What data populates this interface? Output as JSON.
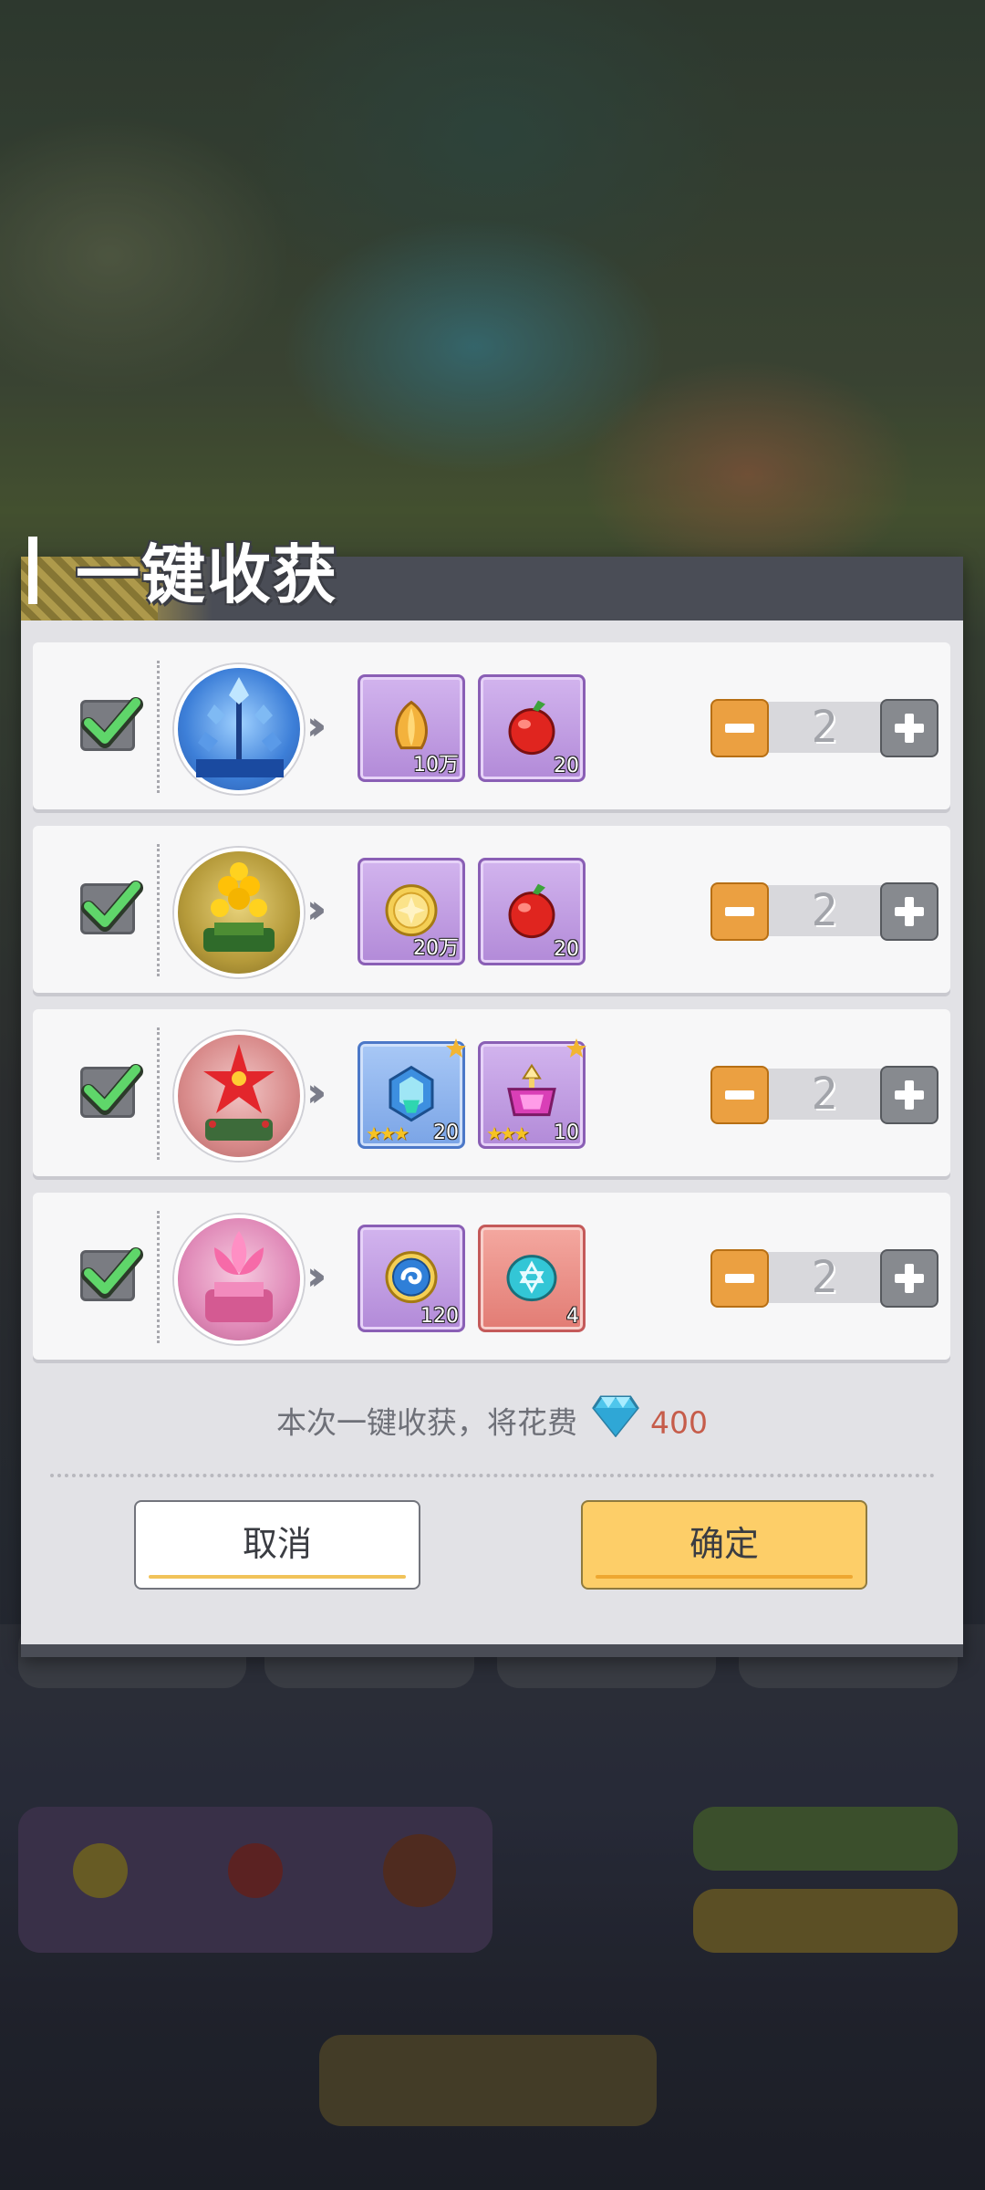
{
  "dialog": {
    "title": "一键收获",
    "rows": [
      {
        "checked": true,
        "plant_icon": "blue-crystal-plant-icon",
        "quantity": "2",
        "rewards": [
          {
            "icon": "golden-tulip-icon",
            "amount": "10万",
            "rarity": "purple"
          },
          {
            "icon": "red-apple-icon",
            "amount": "20",
            "rarity": "purple"
          }
        ]
      },
      {
        "checked": true,
        "plant_icon": "yellow-flower-plant-icon",
        "quantity": "2",
        "rewards": [
          {
            "icon": "gold-coin-icon",
            "amount": "20万",
            "rarity": "purple"
          },
          {
            "icon": "red-apple-icon",
            "amount": "20",
            "rarity": "purple"
          }
        ]
      },
      {
        "checked": true,
        "plant_icon": "red-poinsettia-plant-icon",
        "quantity": "2",
        "rewards": [
          {
            "icon": "blue-crystal-gem-icon",
            "amount": "20",
            "rarity": "blue",
            "stars": "★★★"
          },
          {
            "icon": "pink-crown-gem-icon",
            "amount": "10",
            "rarity": "purple",
            "stars": "★★★"
          }
        ]
      },
      {
        "checked": true,
        "plant_icon": "pink-lotus-plant-icon",
        "quantity": "2",
        "rewards": [
          {
            "icon": "blue-token-icon",
            "amount": "120",
            "rarity": "purple"
          },
          {
            "icon": "cyan-star-stone-icon",
            "amount": "4",
            "rarity": "red"
          }
        ]
      }
    ],
    "cost_text": "本次一键收获，将花费",
    "cost_amount": "400",
    "cancel_label": "取消",
    "confirm_label": "确定"
  },
  "colors": {
    "minus": "#eba041",
    "plus": "#878a8f",
    "confirm": "#fdce68",
    "cost_amount": "#c65c4a"
  }
}
